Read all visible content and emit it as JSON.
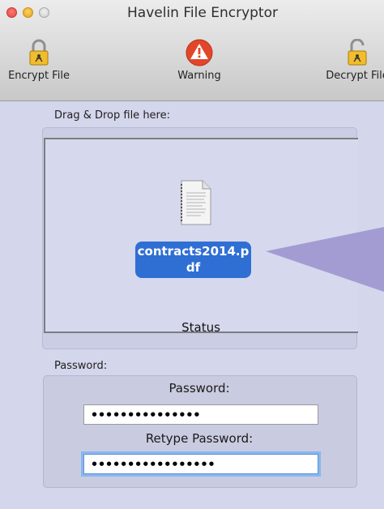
{
  "window": {
    "title": "Havelin File Encryptor",
    "controls": [
      "close",
      "minimize",
      "zoom"
    ]
  },
  "toolbar": {
    "encrypt": {
      "label": "Encrypt File",
      "icon": "lock-icon"
    },
    "warning": {
      "label": "Warning",
      "icon": "warning-icon"
    },
    "decrypt": {
      "label": "Decrypt File",
      "icon": "unlock-icon"
    }
  },
  "drop": {
    "label": "Drag & Drop file here:",
    "file_name_line1": "contracts2014.p",
    "file_name_line2": "df",
    "status": "Status"
  },
  "password": {
    "section_label": "Password:",
    "field_label": "Password:",
    "field_value": "•••••••••••••••",
    "retype_label": "Retype Password:",
    "retype_value": "•••••••••••••••••"
  },
  "colors": {
    "window_bg": "#d4d6ec",
    "warning_red": "#e2462a",
    "selection_blue": "#2f6fd4",
    "focus_ring": "#8ab6ee"
  }
}
